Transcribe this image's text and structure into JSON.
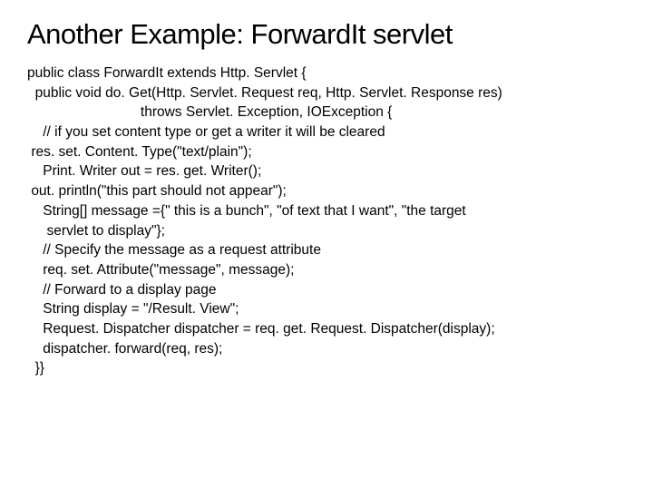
{
  "title": "Another Example: ForwardIt servlet",
  "code": "public class ForwardIt extends Http. Servlet {\n  public void do. Get(Http. Servlet. Request req, Http. Servlet. Response res)\n                             throws Servlet. Exception, IOException {\n    // if you set content type or get a writer it will be cleared\n res. set. Content. Type(\"text/plain\");\n    Print. Writer out = res. get. Writer();\n out. println(\"this part should not appear\");\n    String[] message ={\" this is a bunch\", \"of text that I want\", \"the target\n     servlet to display\"};\n    // Specify the message as a request attribute\n    req. set. Attribute(\"message\", message);\n    // Forward to a display page\n    String display = \"/Result. View\";\n    Request. Dispatcher dispatcher = req. get. Request. Dispatcher(display);\n    dispatcher. forward(req, res);\n  }}"
}
